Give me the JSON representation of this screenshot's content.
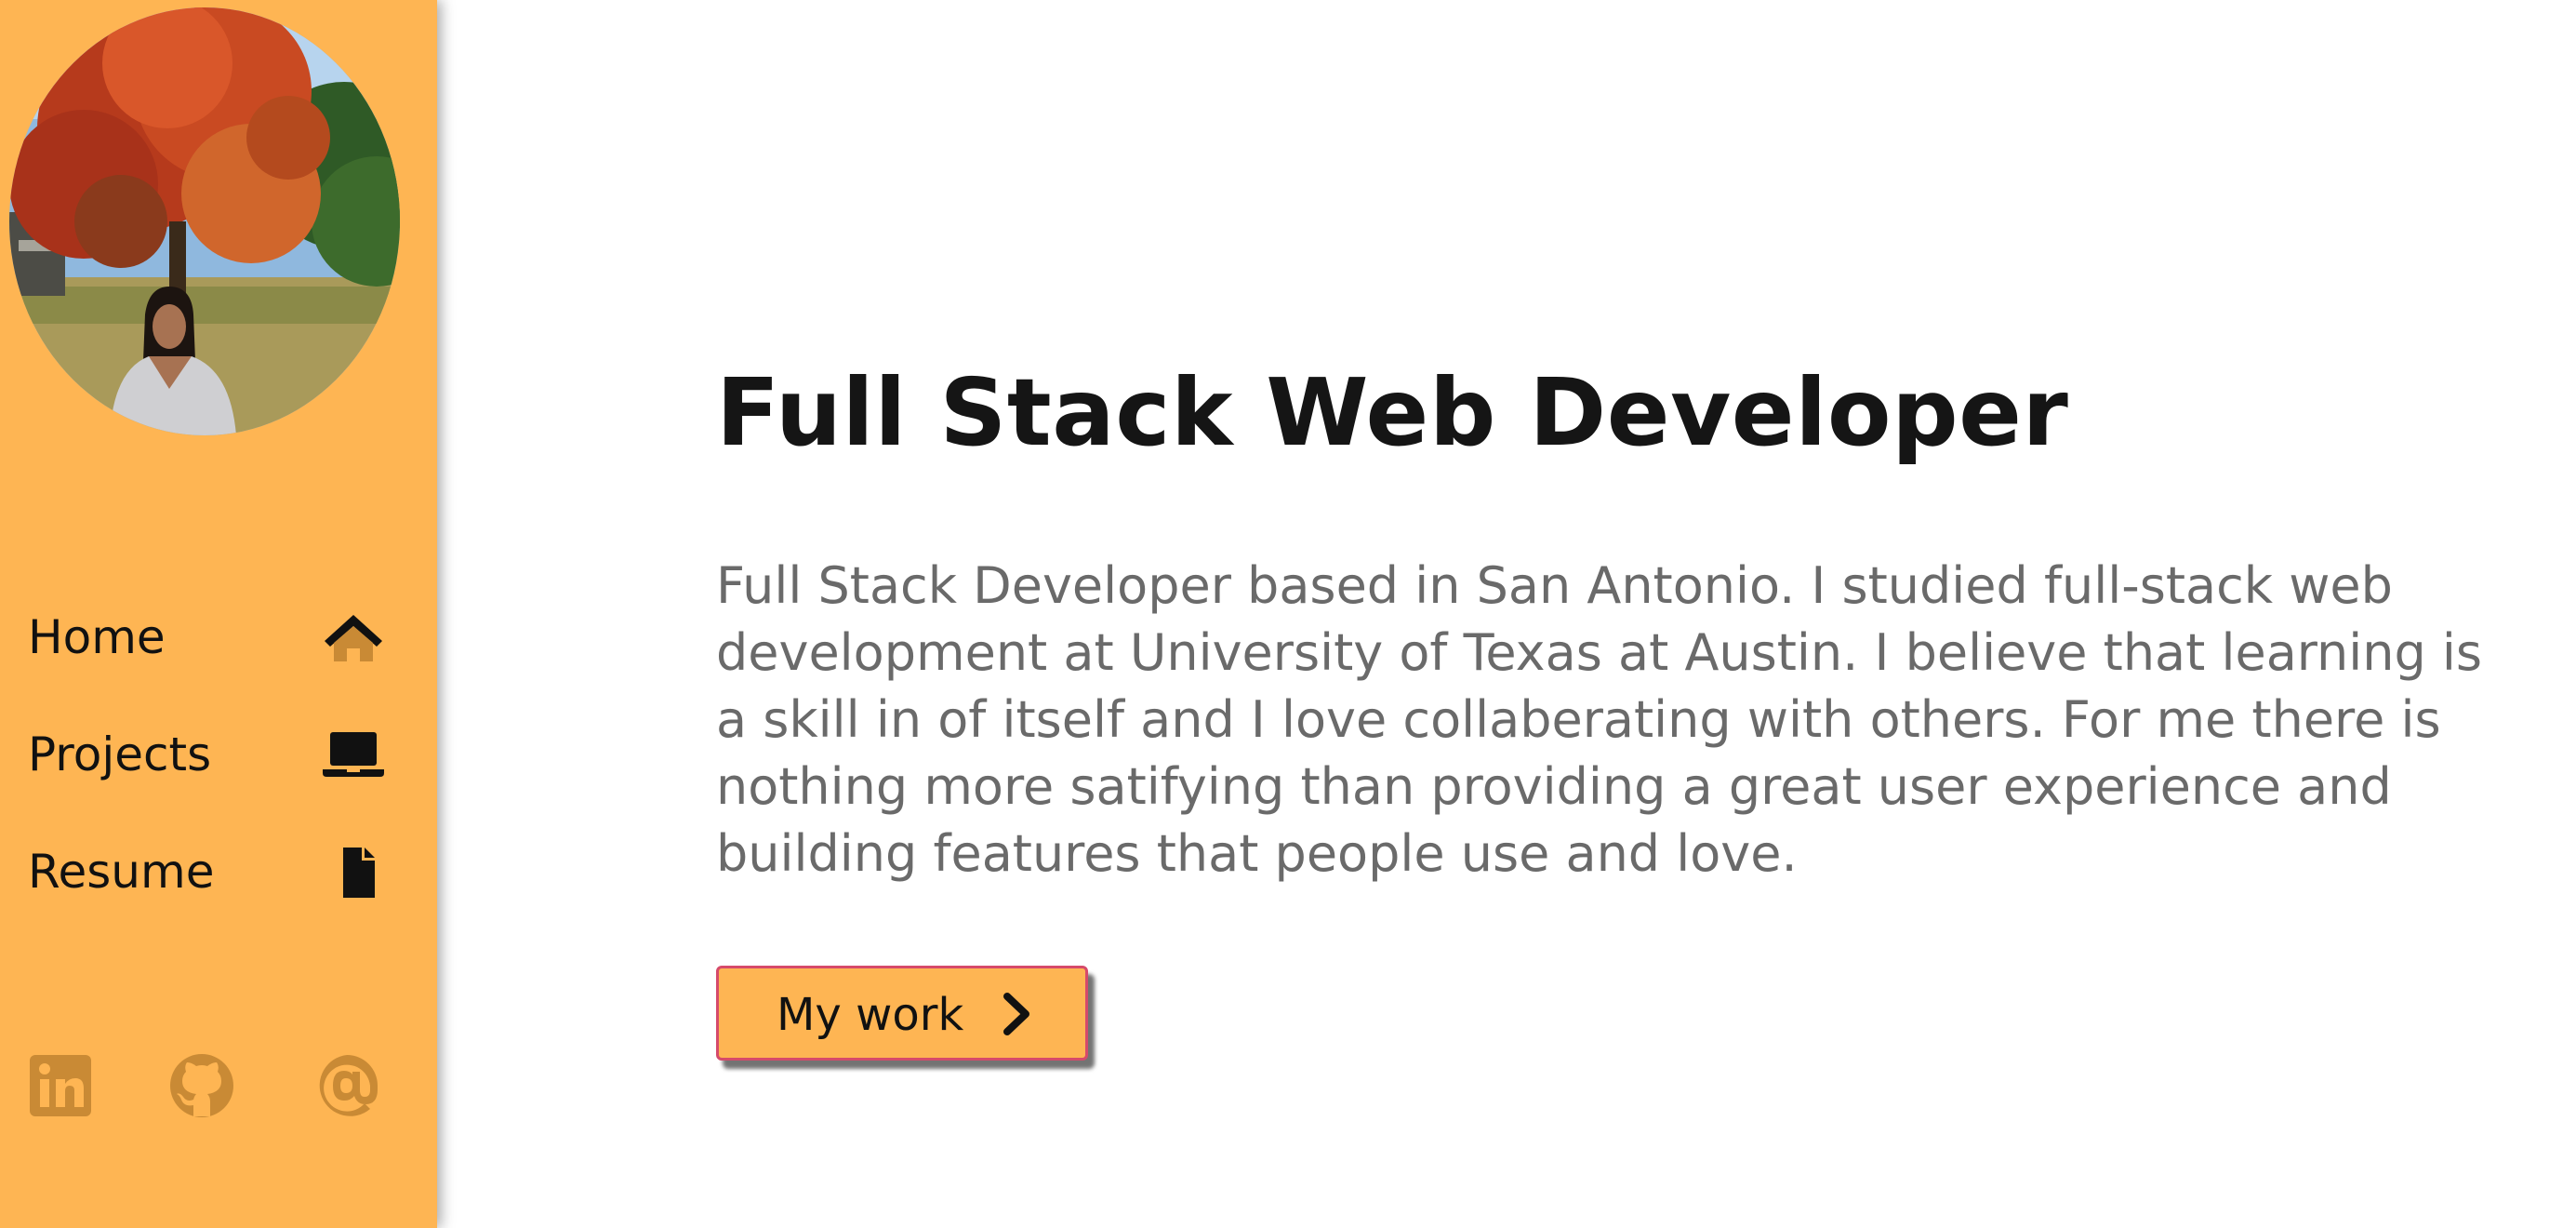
{
  "sidebar": {
    "avatar_alt": "Profile photo",
    "nav": [
      {
        "label": "Home",
        "icon": "home-icon"
      },
      {
        "label": "Projects",
        "icon": "laptop-icon"
      },
      {
        "label": "Resume",
        "icon": "file-icon"
      }
    ],
    "social": [
      {
        "icon": "linkedin-icon"
      },
      {
        "icon": "github-icon"
      },
      {
        "icon": "at-icon"
      }
    ]
  },
  "main": {
    "headline": "Full Stack Web Developer",
    "bio": "Full Stack Developer based in San Antonio. I studied full-stack web development at University of Texas at Austin. I believe that learning is a skill in of itself and I love collaberating with others. For me there is nothing more satifying than providing a great user experience and building features that people use and love.",
    "cta_label": "My work",
    "cta_icon": "chevron-right-icon"
  },
  "colors": {
    "sidebar_bg": "#FEB553",
    "icon_brown": "#C98A35",
    "cta_border": "#D64A6A",
    "headline": "#151515",
    "body_text": "#6A6A6A"
  }
}
